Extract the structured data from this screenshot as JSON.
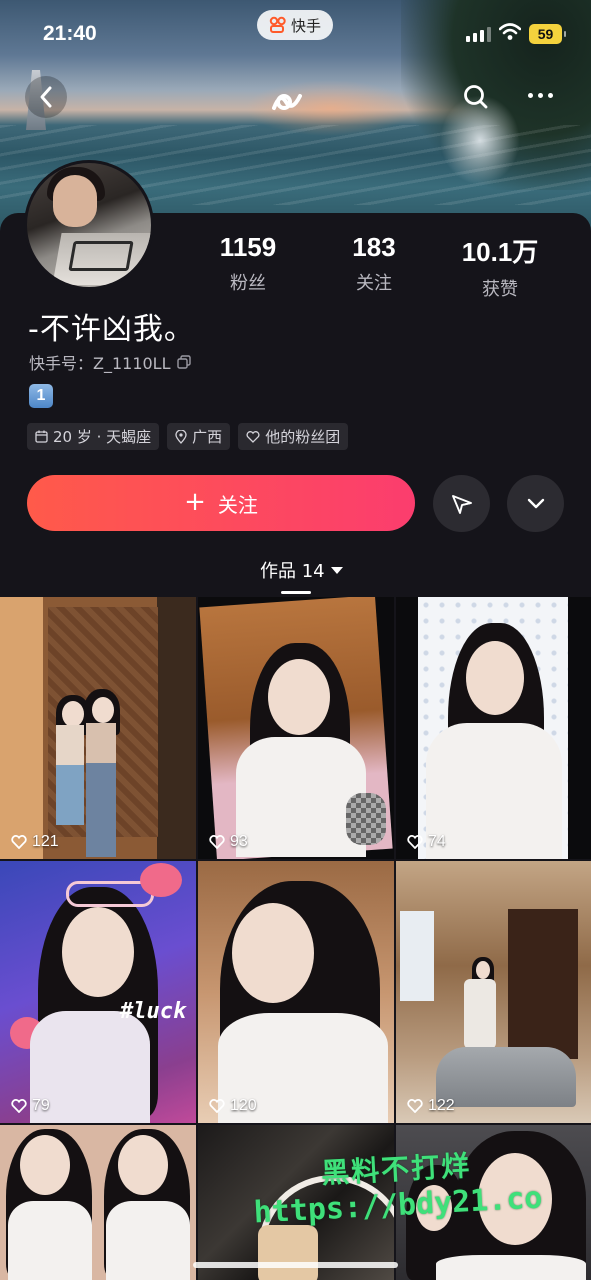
{
  "status_bar": {
    "time": "21:40",
    "app_name": "快手",
    "battery": "59"
  },
  "profile": {
    "name": "-不许凶我。",
    "kuaishou_id": "快手号：Z_1110LL",
    "badge_emoji": "1",
    "stats": [
      {
        "value": "1159",
        "label": "粉丝"
      },
      {
        "value": "183",
        "label": "关注"
      },
      {
        "value": "10.1万",
        "label": "获赞"
      }
    ],
    "tags": [
      {
        "icon": "calendar-icon",
        "text": "20 岁 · 天蝎座"
      },
      {
        "icon": "location-icon",
        "text": "广西"
      },
      {
        "icon": "heart-icon",
        "text": "他的粉丝团"
      }
    ]
  },
  "actions": {
    "follow_label": "关注"
  },
  "works_tab": {
    "label": "作品 14"
  },
  "posts": [
    {
      "likes": "121"
    },
    {
      "likes": "93"
    },
    {
      "likes": "74"
    },
    {
      "likes": "79"
    },
    {
      "likes": "120"
    },
    {
      "likes": "122"
    },
    {
      "likes": ""
    },
    {
      "likes": ""
    },
    {
      "likes": ""
    }
  ],
  "overlay_text": {
    "luck": "#luck"
  },
  "watermark": {
    "line1": "黑料不打烊",
    "line2": "https://bdy21.co"
  },
  "colors": {
    "follow_gradient_start": "#ff5a4a",
    "follow_gradient_end": "#fb3d6e",
    "background": "#15141a",
    "watermark": "#3fe07a"
  }
}
